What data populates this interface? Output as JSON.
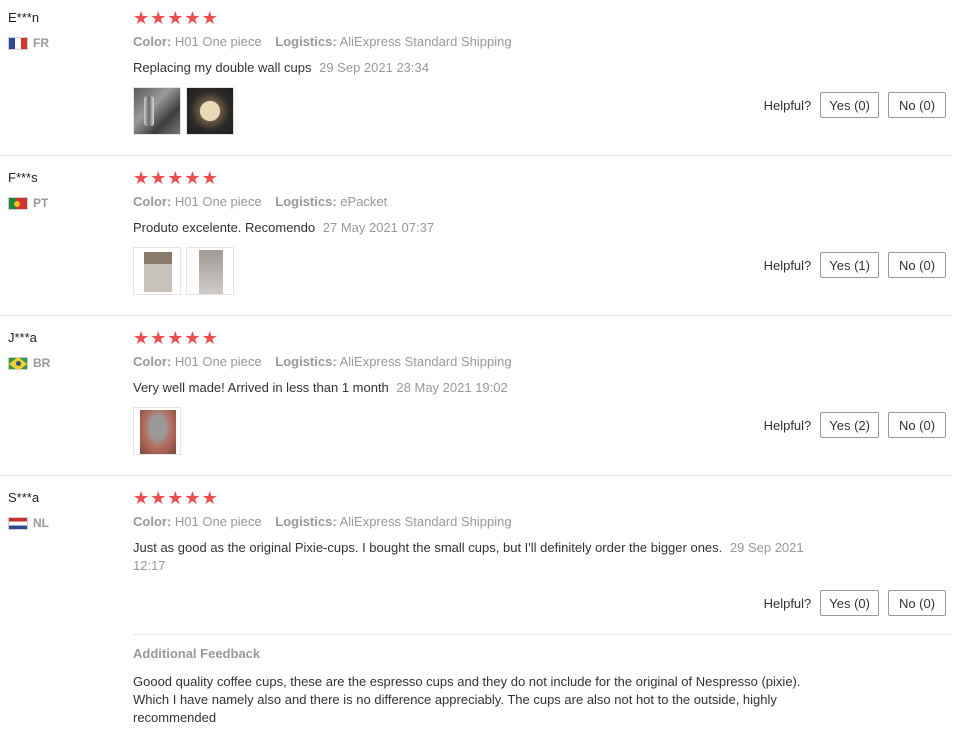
{
  "helpful_label": "Helpful?",
  "star_glyph": "★",
  "colors": {
    "star": "#f04c4c",
    "muted": "#999999",
    "border": "#e8e8e8"
  },
  "reviews": [
    {
      "user": "E***n",
      "country": "FR",
      "rating": 5,
      "color_label": "Color:",
      "color_value": "H01 One piece",
      "logistics_label": "Logistics:",
      "logistics_value": "AliExpress Standard Shipping",
      "text": "Replacing my double wall cups",
      "date": "29 Sep 2021 23:34",
      "photos": [
        "photo-cup-pair",
        "photo-cup-top"
      ],
      "yes": "Yes (0)",
      "no": "No (0)"
    },
    {
      "user": "F***s",
      "country": "PT",
      "rating": 5,
      "color_label": "Color:",
      "color_value": "H01 One piece",
      "logistics_label": "Logistics:",
      "logistics_value": "ePacket",
      "text": "Produto excelente. Recomendo",
      "date": "27 May 2021 07:37",
      "photos": [
        "photo-cup-side",
        "photo-cup-side-2"
      ],
      "yes": "Yes (1)",
      "no": "No (0)"
    },
    {
      "user": "J***a",
      "country": "BR",
      "rating": 5,
      "color_label": "Color:",
      "color_value": "H01 One piece",
      "logistics_label": "Logistics:",
      "logistics_value": "AliExpress Standard Shipping",
      "text": "Very well made! Arrived in less than 1 month",
      "date": "28 May 2021 19:02",
      "photos": [
        "photo-cup-hand"
      ],
      "yes": "Yes (2)",
      "no": "No (0)"
    },
    {
      "user": "S***a",
      "country": "NL",
      "rating": 5,
      "color_label": "Color:",
      "color_value": "H01 One piece",
      "logistics_label": "Logistics:",
      "logistics_value": "AliExpress Standard Shipping",
      "text": "Just as good as the original Pixie-cups. I bought the small cups, but I'll definitely order the bigger ones.",
      "date": "29 Sep 2021 12:17",
      "photos": [],
      "yes": "Yes (0)",
      "no": "No (0)",
      "additional_feedback_title": "Additional Feedback",
      "additional_feedback_text": "Goood quality coffee cups, these are the espresso cups and they do not include for the original of Nespresso (pixie). Which I have namely also and there is no difference appreciably. The cups are also not hot to the outside, highly recommended"
    }
  ]
}
